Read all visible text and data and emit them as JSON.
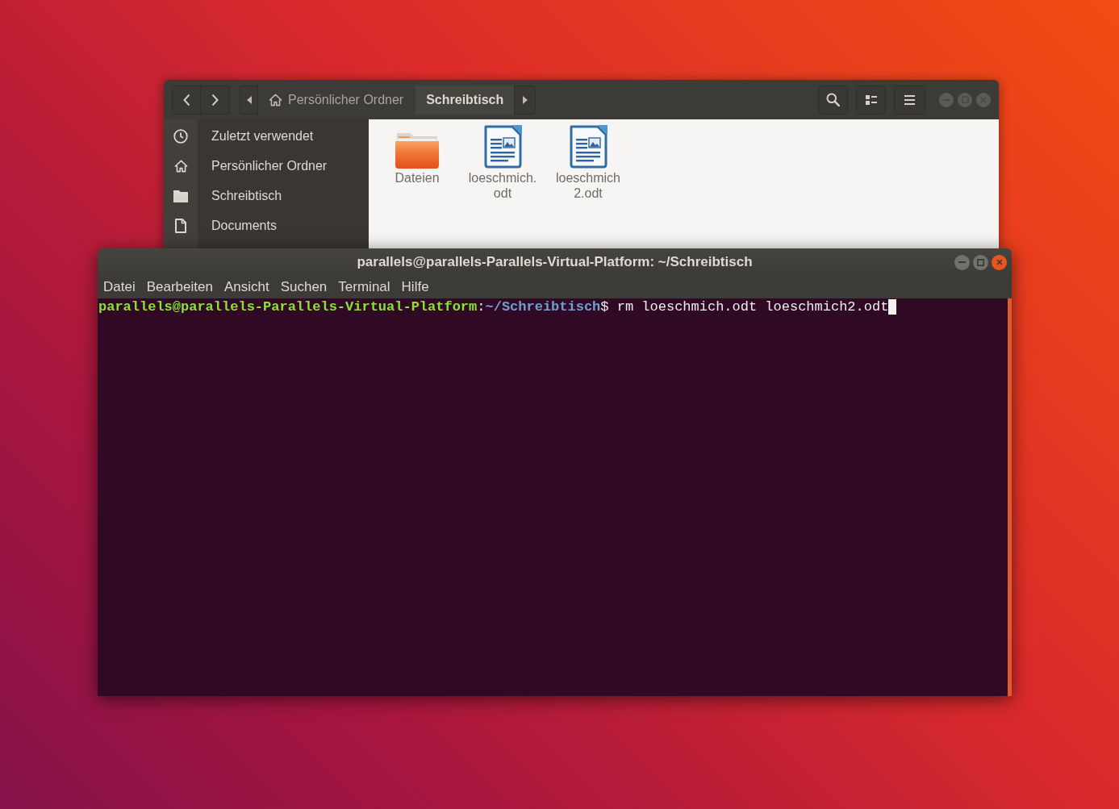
{
  "file_manager": {
    "focused": false,
    "path_bar": [
      {
        "label": "Persönlicher Ordner",
        "kind": "home",
        "selected": false
      },
      {
        "label": "Schreibtisch",
        "kind": "folder",
        "selected": true
      }
    ],
    "sidebar": {
      "items": [
        {
          "label": "Zuletzt verwendet",
          "kind": "recent",
          "selected": false
        },
        {
          "label": "Persönlicher Ordner",
          "kind": "home",
          "selected": false
        },
        {
          "label": "Schreibtisch",
          "kind": "desktop",
          "selected": false
        },
        {
          "label": "Documents",
          "kind": "documents",
          "selected": false
        }
      ]
    },
    "files": [
      {
        "label_lines": [
          "Dateien"
        ],
        "kind": "folder",
        "selected": false
      },
      {
        "label_lines": [
          "loeschmich.",
          "odt"
        ],
        "kind": "document",
        "selected": false
      },
      {
        "label_lines": [
          "loeschmich",
          "2.odt"
        ],
        "kind": "document",
        "selected": false
      }
    ]
  },
  "terminal": {
    "focused": true,
    "title": "parallels@parallels-Parallels-Virtual-Platform: ~/Schreibtisch",
    "menu": [
      "Datei",
      "Bearbeiten",
      "Ansicht",
      "Suchen",
      "Terminal",
      "Hilfe"
    ],
    "lines": [
      {
        "segments": [
          {
            "kind": "user",
            "text": "parallels@parallels-Parallels-Virtual-Platform"
          },
          {
            "kind": "plain",
            "text": ":"
          },
          {
            "kind": "path",
            "text": "~/Schreibtisch"
          },
          {
            "kind": "plain",
            "text": "$ rm loeschmich.odt loeschmich2.odt"
          }
        ],
        "cursor": true
      }
    ]
  }
}
